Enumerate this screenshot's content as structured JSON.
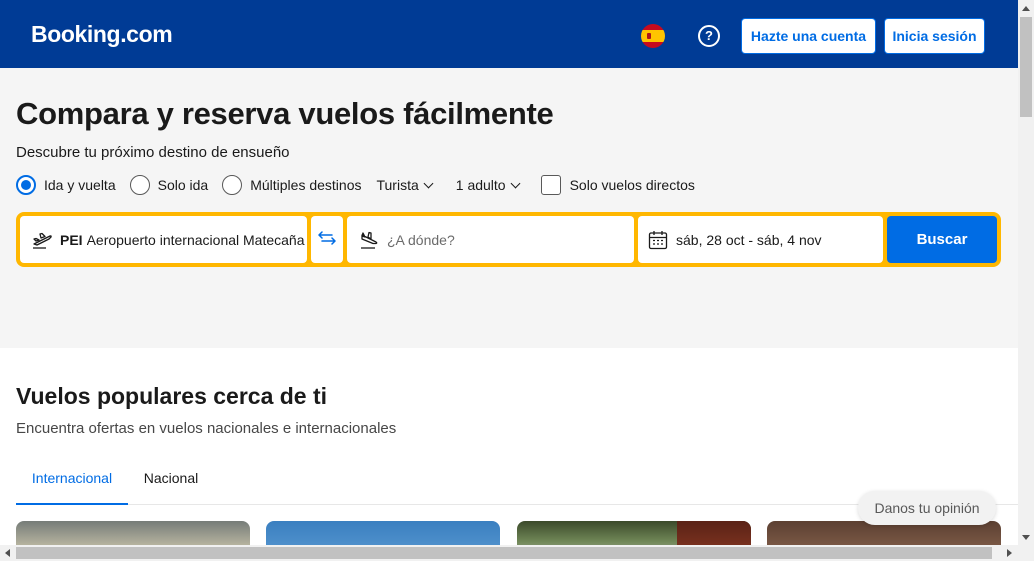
{
  "header": {
    "logo": "Booking.com",
    "language_flag": "spain-flag-icon",
    "help_icon": "?",
    "register_label": "Hazte una cuenta",
    "login_label": "Inicia sesión",
    "bg_color": "#003b95"
  },
  "hero": {
    "title": "Compara y reserva vuelos fácilmente",
    "subtitle": "Descubre tu próximo destino de ensueño",
    "trip_types": [
      {
        "label": "Ida y vuelta",
        "selected": true
      },
      {
        "label": "Solo ida",
        "selected": false
      },
      {
        "label": "Múltiples destinos",
        "selected": false
      }
    ],
    "cabin_class": "Turista",
    "passengers": "1 adulto",
    "direct_only": {
      "label": "Solo vuelos directos",
      "checked": false
    }
  },
  "search": {
    "from_code": "PEI",
    "from_name": "Aeropuerto internacional Matecaña",
    "to_placeholder": "¿A dónde?",
    "dates": "sáb, 28 oct - sáb, 4 nov",
    "search_label": "Buscar",
    "accent_color": "#ffb700",
    "button_color": "#006ce4"
  },
  "popular": {
    "title": "Vuelos populares cerca de ti",
    "subtitle": "Encuentra ofertas en vuelos nacionales e internacionales",
    "tabs": [
      {
        "label": "Internacional",
        "active": true
      },
      {
        "label": "Nacional",
        "active": false
      }
    ]
  },
  "feedback": {
    "label": "Danos tu opinión"
  }
}
